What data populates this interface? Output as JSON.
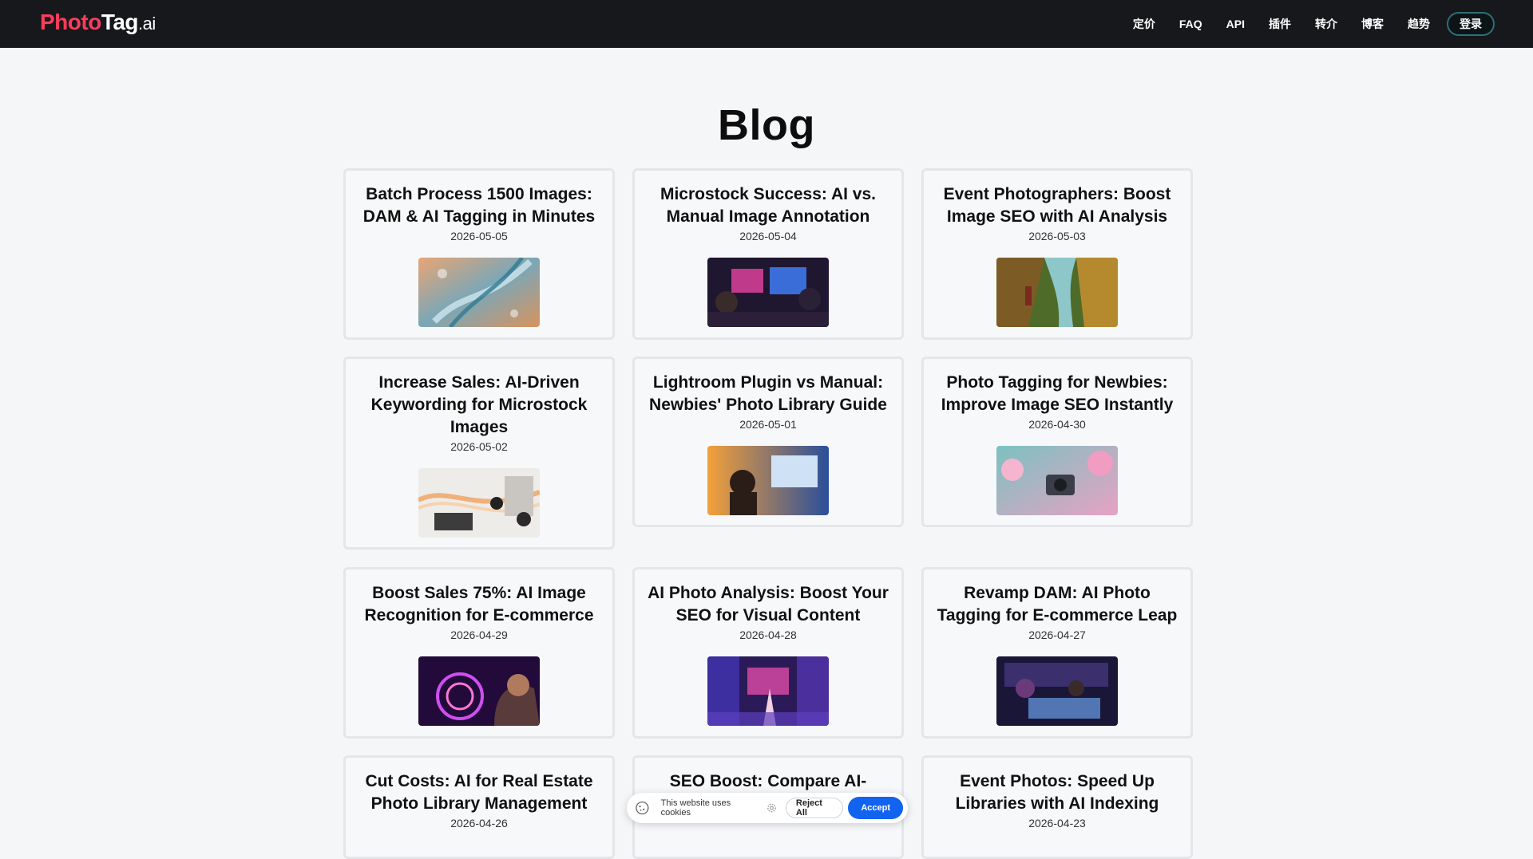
{
  "header": {
    "logo": {
      "part1": "Photo",
      "part2": "Tag",
      "part3": ".ai"
    },
    "nav": [
      "定价",
      "FAQ",
      "API",
      "插件",
      "转介",
      "博客",
      "趋势"
    ],
    "login_label": "登录"
  },
  "page": {
    "title": "Blog"
  },
  "posts": [
    {
      "title": "Batch Process 1500 Images: DAM & AI Tagging in Minutes",
      "date": "2026-05-05"
    },
    {
      "title": "Microstock Success: AI vs. Manual Image Annotation",
      "date": "2026-05-04"
    },
    {
      "title": "Event Photographers: Boost Image SEO with AI Analysis",
      "date": "2026-05-03"
    },
    {
      "title": "Increase Sales: AI-Driven Keywording for Microstock Images",
      "date": "2026-05-02"
    },
    {
      "title": "Lightroom Plugin vs Manual: Newbies' Photo Library Guide",
      "date": "2026-05-01"
    },
    {
      "title": "Photo Tagging for Newbies: Improve Image SEO Instantly",
      "date": "2026-04-30"
    },
    {
      "title": "Boost Sales 75%: AI Image Recognition for E-commerce",
      "date": "2026-04-29"
    },
    {
      "title": "AI Photo Analysis: Boost Your SEO for Visual Content",
      "date": "2026-04-28"
    },
    {
      "title": "Revamp DAM: AI Photo Tagging for E-commerce Leap",
      "date": "2026-04-27"
    },
    {
      "title": "Cut Costs: AI for Real Estate Photo Library Management",
      "date": "2026-04-26"
    },
    {
      "title": "SEO Boost: Compare AI-Tools",
      "date": ""
    },
    {
      "title": "Event Photos: Speed Up Libraries with AI Indexing",
      "date": "2026-04-23"
    }
  ],
  "cookie": {
    "text": "This website uses cookies",
    "reject_label": "Reject All",
    "accept_label": "Accept",
    "accept_color": "#1363f1"
  },
  "colors": {
    "brand": "#ff3b5c",
    "header_bg": "#17181b"
  }
}
